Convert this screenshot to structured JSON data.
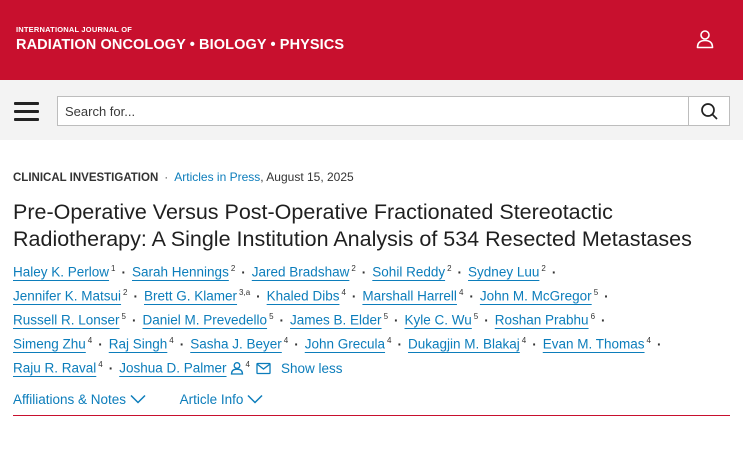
{
  "header": {
    "journal_prefix": "INTERNATIONAL JOURNAL OF",
    "journal_name": "RADIATION ONCOLOGY • BIOLOGY • PHYSICS",
    "brand_color": "#c8102e",
    "user_icon": "person-icon"
  },
  "search": {
    "placeholder": "Search for...",
    "menu_icon": "hamburger-menu-icon",
    "search_icon": "magnifier-icon"
  },
  "meta": {
    "article_type": "CLINICAL INVESTIGATION",
    "status_link": "Articles in Press",
    "date": ", August 15, 2025"
  },
  "title": "Pre-Operative Versus Post-Operative Fractionated Stereotactic Radiotherapy: A Single Institution Analysis of 534 Resected Metastases",
  "authors": {
    "perlow": {
      "name": "Haley K. Perlow",
      "aff": "1"
    },
    "hennings": {
      "name": "Sarah Hennings",
      "aff": "2"
    },
    "bradshaw": {
      "name": "Jared Bradshaw",
      "aff": "2"
    },
    "reddy": {
      "name": "Sohil Reddy",
      "aff": "2"
    },
    "luu": {
      "name": "Sydney Luu",
      "aff": "2"
    },
    "matsui": {
      "name": "Jennifer K. Matsui",
      "aff": "2"
    },
    "klamer": {
      "name": "Brett G. Klamer",
      "aff": "3,a"
    },
    "dibs": {
      "name": "Khaled Dibs",
      "aff": "4"
    },
    "harrell": {
      "name": "Marshall Harrell",
      "aff": "4"
    },
    "mcgregor": {
      "name": "John M. McGregor",
      "aff": "5"
    },
    "lonser": {
      "name": "Russell R. Lonser",
      "aff": "5"
    },
    "prevedello": {
      "name": "Daniel M. Prevedello",
      "aff": "5"
    },
    "elder": {
      "name": "James B. Elder",
      "aff": "5"
    },
    "wu": {
      "name": "Kyle C. Wu",
      "aff": "5"
    },
    "prabhu": {
      "name": "Roshan Prabhu",
      "aff": "6"
    },
    "zhu": {
      "name": "Simeng Zhu",
      "aff": "4"
    },
    "singh": {
      "name": "Raj Singh",
      "aff": "4"
    },
    "beyer": {
      "name": "Sasha J. Beyer",
      "aff": "4"
    },
    "grecula": {
      "name": "John Grecula",
      "aff": "4"
    },
    "blakaj": {
      "name": "Dukagjin M. Blakaj",
      "aff": "4"
    },
    "thomas": {
      "name": "Evan M. Thomas",
      "aff": "4"
    },
    "raval": {
      "name": "Raju R. Raval",
      "aff": "4"
    },
    "palmer": {
      "name": "Joshua D. Palmer",
      "aff": "4"
    }
  },
  "show_less": "Show less",
  "tabs": {
    "affiliations": "Affiliations & Notes",
    "article_info": "Article Info"
  },
  "link_color": "#0c7dbb"
}
